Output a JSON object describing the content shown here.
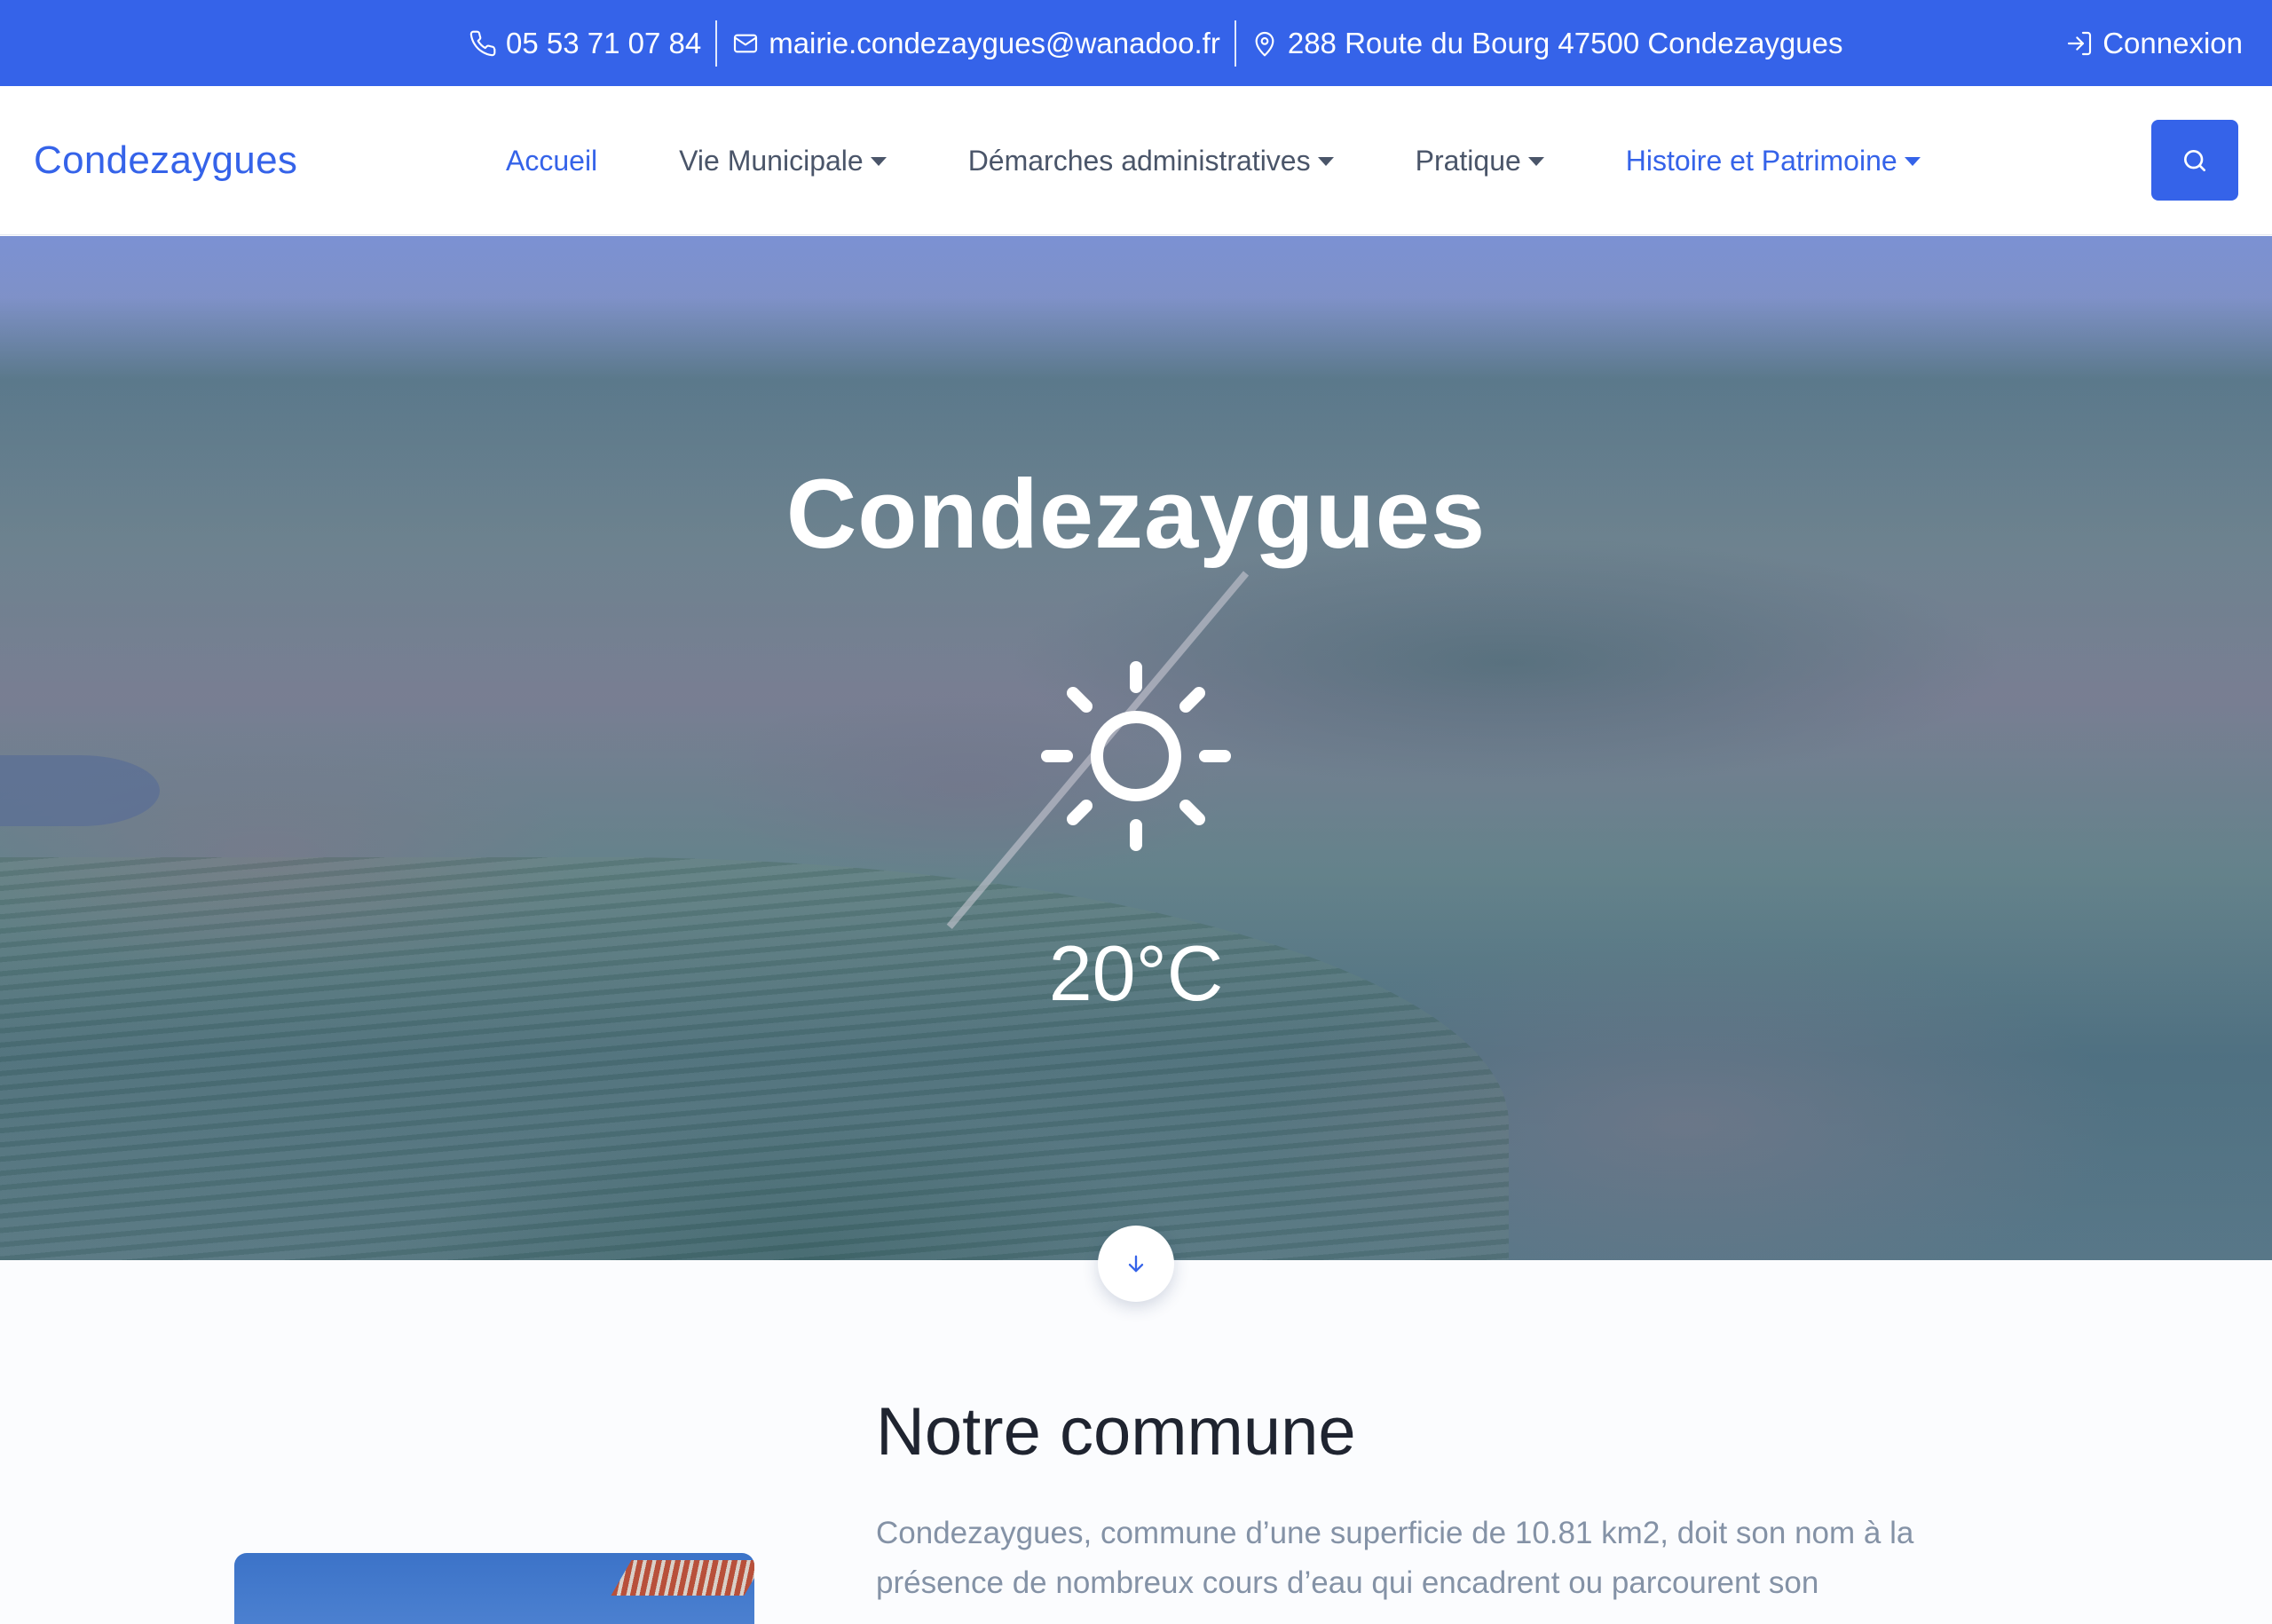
{
  "topbar": {
    "phone": "05 53 71 07 84",
    "email": "mairie.condezaygues@wanadoo.fr",
    "address": "288 Route du Bourg 47500 Condezaygues",
    "login_label": "Connexion"
  },
  "navbar": {
    "brand": "Condezaygues",
    "items": [
      {
        "label": "Accueil"
      },
      {
        "label": "Vie Municipale"
      },
      {
        "label": "Démarches administratives"
      },
      {
        "label": "Pratique"
      },
      {
        "label": "Histoire et Patrimoine"
      }
    ]
  },
  "hero": {
    "title": "Condezaygues",
    "weather_icon": "sun-icon",
    "temperature": "20°C"
  },
  "section": {
    "title": "Notre commune",
    "text": "Condezaygues, commune d’une superficie de 10.81 km2, doit son nom à la présence de nombreux cours d’eau qui encadrent ou parcourent son"
  },
  "colors": {
    "primary": "#3563e9",
    "nav_text": "#4a5569",
    "heading": "#1f2430",
    "body_text": "#8492a6"
  }
}
